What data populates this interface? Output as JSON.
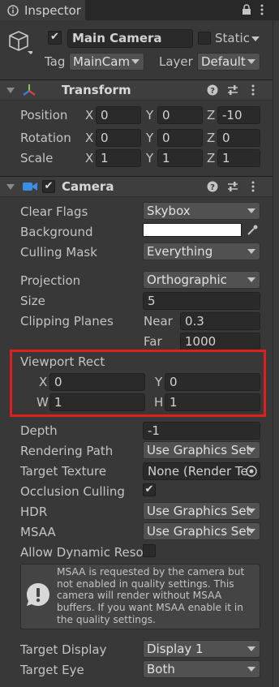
{
  "tab": {
    "title": "Inspector"
  },
  "object": {
    "name": "Main Camera",
    "active": true,
    "static_label": "Static",
    "tag_label": "Tag",
    "tag_value": "MainCam",
    "layer_label": "Layer",
    "layer_value": "Default"
  },
  "transform": {
    "title": "Transform",
    "position": {
      "label": "Position",
      "x": "0",
      "y": "0",
      "z": "-10"
    },
    "rotation": {
      "label": "Rotation",
      "x": "0",
      "y": "0",
      "z": "0"
    },
    "scale": {
      "label": "Scale",
      "x": "1",
      "y": "1",
      "z": "1"
    },
    "axes": {
      "x": "X",
      "y": "Y",
      "z": "Z"
    }
  },
  "camera": {
    "title": "Camera",
    "clear_flags": {
      "label": "Clear Flags",
      "value": "Skybox"
    },
    "background": {
      "label": "Background",
      "color": "#ffffff"
    },
    "culling_mask": {
      "label": "Culling Mask",
      "value": "Everything"
    },
    "projection": {
      "label": "Projection",
      "value": "Orthographic"
    },
    "size": {
      "label": "Size",
      "value": "5"
    },
    "clipping": {
      "label": "Clipping Planes",
      "near_label": "Near",
      "near": "0.3",
      "far_label": "Far",
      "far": "1000"
    },
    "viewport": {
      "label": "Viewport Rect",
      "x_label": "X",
      "x": "0",
      "y_label": "Y",
      "y": "0",
      "w_label": "W",
      "w": "1",
      "h_label": "H",
      "h": "1"
    },
    "depth": {
      "label": "Depth",
      "value": "-1"
    },
    "rendering_path": {
      "label": "Rendering Path",
      "value": "Use Graphics Set"
    },
    "target_texture": {
      "label": "Target Texture",
      "value": "None (Render Te"
    },
    "occlusion": {
      "label": "Occlusion Culling",
      "checked": true
    },
    "hdr": {
      "label": "HDR",
      "value": "Use Graphics Set"
    },
    "msaa": {
      "label": "MSAA",
      "value": "Use Graphics Set"
    },
    "dynamic_res": {
      "label": "Allow Dynamic Reso",
      "checked": false
    },
    "msaa_warning": "MSAA is requested by the camera but not enabled in quality settings. This camera will render without MSAA buffers. If you want MSAA enable it in the quality settings.",
    "target_display": {
      "label": "Target Display",
      "value": "Display 1"
    },
    "target_eye": {
      "label": "Target Eye",
      "value": "Both"
    }
  },
  "colors": {
    "highlight": "#e01e1e",
    "background": "#383838"
  }
}
